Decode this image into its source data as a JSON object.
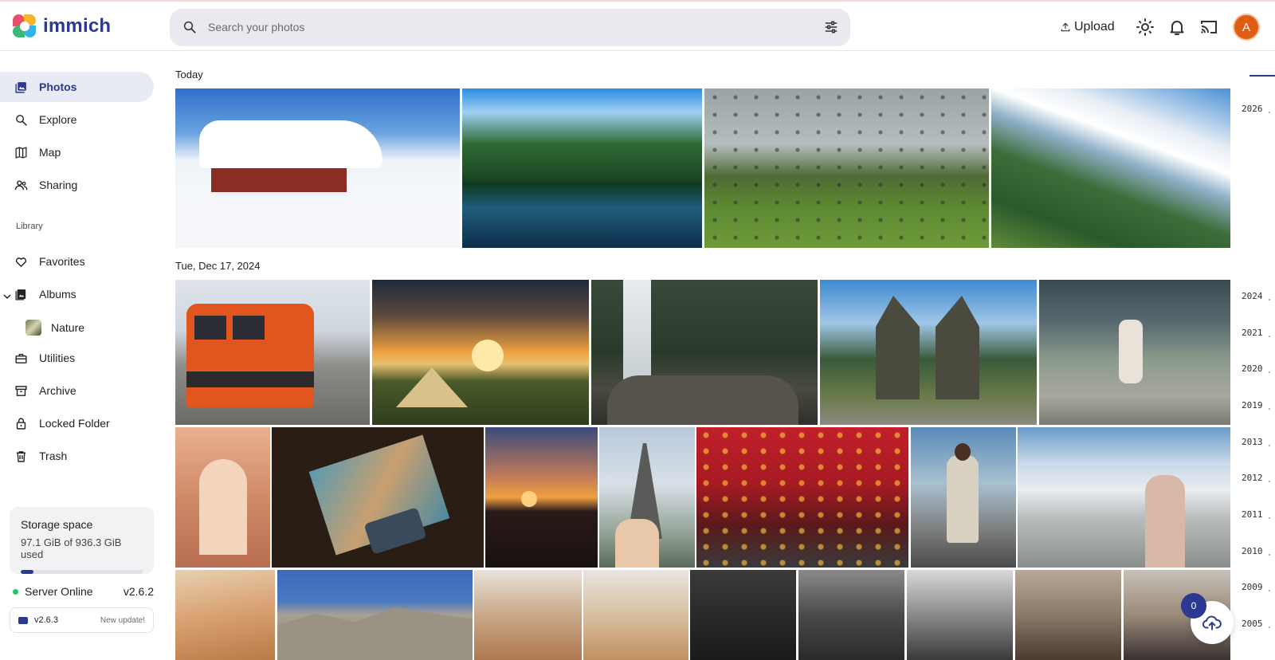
{
  "app": {
    "name": "immich",
    "brand_color": "#2b3990"
  },
  "header": {
    "search_placeholder": "Search your photos",
    "upload_label": "Upload",
    "avatar_initial": "A",
    "icons": [
      "search-icon",
      "filter-icon",
      "upload-icon",
      "theme-icon",
      "bell-icon",
      "cast-icon"
    ]
  },
  "sidebar": {
    "items": [
      {
        "label": "Photos",
        "icon": "photos-icon",
        "active": true
      },
      {
        "label": "Explore",
        "icon": "explore-icon"
      },
      {
        "label": "Map",
        "icon": "map-icon"
      },
      {
        "label": "Sharing",
        "icon": "sharing-icon"
      }
    ],
    "library_heading": "Library",
    "library_items": [
      {
        "label": "Favorites",
        "icon": "heart-icon"
      },
      {
        "label": "Albums",
        "icon": "album-icon"
      },
      {
        "label": "Utilities",
        "icon": "utilities-icon"
      },
      {
        "label": "Archive",
        "icon": "archive-icon"
      },
      {
        "label": "Locked Folder",
        "icon": "lock-icon"
      },
      {
        "label": "Trash",
        "icon": "trash-icon"
      }
    ],
    "album_child": "Nature",
    "storage": {
      "title": "Storage space",
      "usage": "97.1 GiB of 936.3 GiB used",
      "fraction": 0.104
    },
    "server": {
      "status": "Server Online",
      "version": "v2.6.2"
    },
    "update": {
      "version": "v2.6.3",
      "note": "New update!"
    }
  },
  "timeline": {
    "groups": [
      {
        "label": "Today"
      },
      {
        "label": "Tue, Dec 17, 2024"
      }
    ]
  },
  "scrubber": {
    "years": [
      "2026",
      "2024",
      "2021",
      "2020",
      "2019",
      "2013",
      "2012",
      "2011",
      "2010",
      "2009",
      "2005"
    ]
  },
  "upload_queue": {
    "count": "0"
  }
}
